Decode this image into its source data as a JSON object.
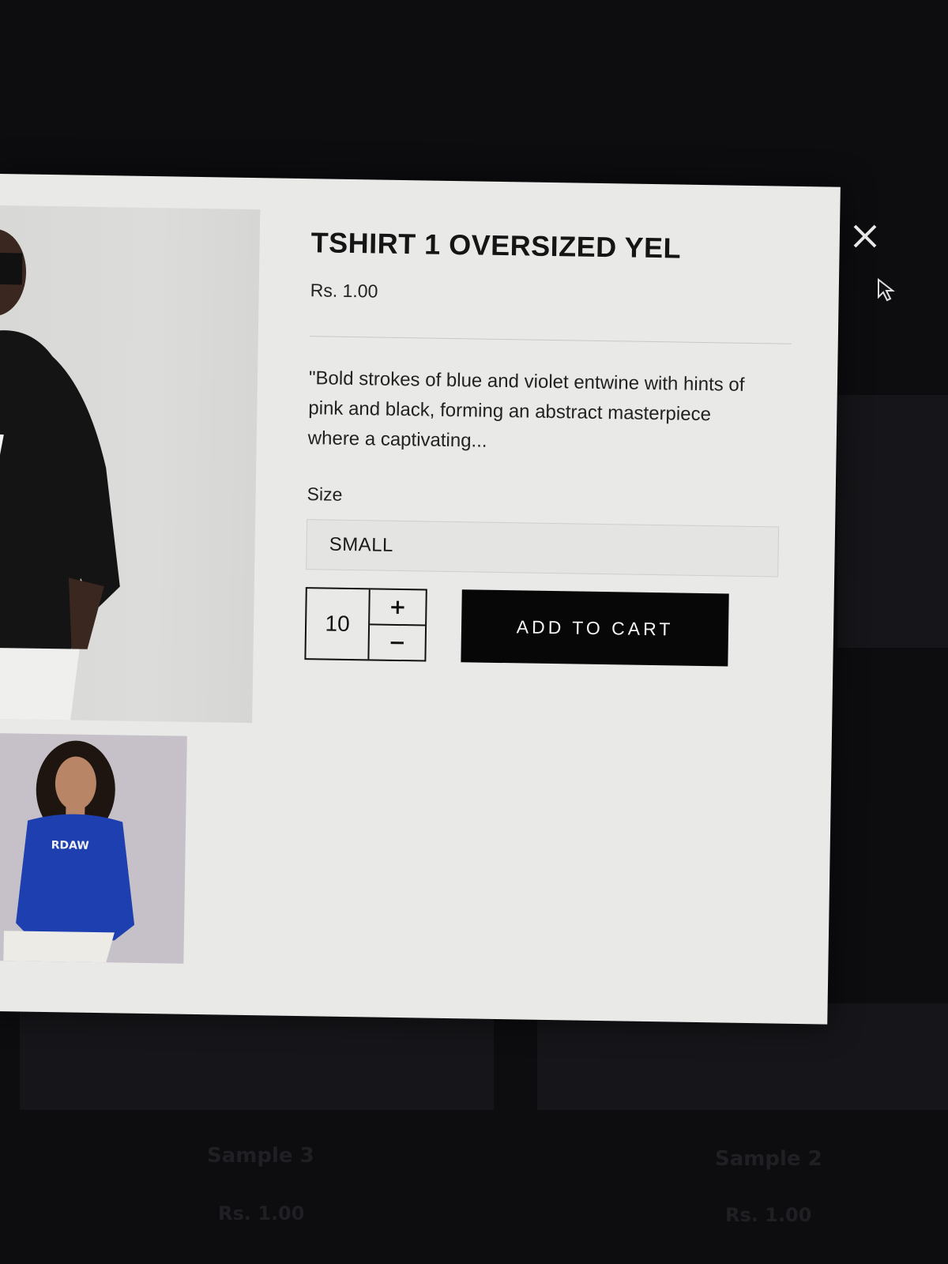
{
  "modal": {
    "title": "TSHIRT 1 OVERSIZED YEL",
    "price": "Rs. 1.00",
    "description": "\"Bold strokes of blue and violet entwine with hints of pink and black, forming an abstract masterpiece where a captivating...",
    "size_label": "Size",
    "size_value": "SMALL",
    "quantity": "10",
    "qty_increase": "+",
    "qty_decrease": "−",
    "add_to_cart": "ADD TO CART"
  },
  "background_cards": [
    {
      "title": "Sample 3",
      "price": "Rs. 1.00"
    },
    {
      "title": "Sample 2",
      "price": "Rs. 1.00"
    }
  ],
  "icons": {
    "close": "close-icon",
    "cursor": "mouse-pointer-icon"
  },
  "colors": {
    "modal_bg": "#e9e9e7",
    "button_bg": "#070707",
    "overlay": "#0d0d10"
  }
}
